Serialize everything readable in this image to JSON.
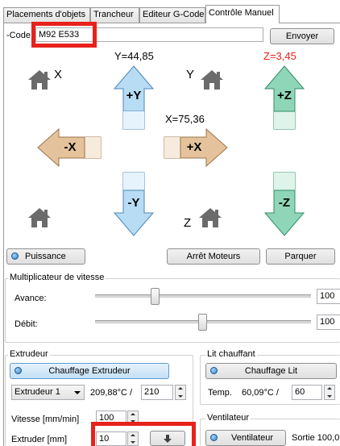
{
  "tabs": [
    "Placements d'objets",
    "Trancheur",
    "Editeur G-Code",
    "Contrôle Manuel"
  ],
  "gcode": {
    "label": "-Code",
    "value": "M92 E533",
    "send": "Envoyer"
  },
  "positions": {
    "x": "X=75,36",
    "y": "Y=44,85",
    "z": "Z=3,45"
  },
  "home_labels": {
    "x": "X",
    "y": "Y",
    "z": "Z"
  },
  "jog": {
    "plus_y": "+Y",
    "minus_y": "-Y",
    "plus_x": "+X",
    "minus_x": "-X",
    "plus_z": "+Z",
    "minus_z": "-Z"
  },
  "power": {
    "label": "Puissance",
    "stop_motors": "Arrêt Moteurs",
    "park": "Parquer"
  },
  "speed": {
    "title": "Multiplicateur de vitesse",
    "feed_label": "Avance:",
    "feed_value": "100",
    "flow_label": "Débit:",
    "flow_value": "100"
  },
  "extruder": {
    "title": "Extrudeur",
    "heat": "Chauffage Extrudeur",
    "select": "Extrudeur 1",
    "temp": "209,88°C /",
    "target": "210",
    "speed_label": "Vitesse [mm/min]",
    "speed_value": "100",
    "extrude_label": "Extruder [mm]",
    "extrude_value": "10"
  },
  "bed": {
    "title": "Lit chauffant",
    "heat": "Chauffage Lit",
    "temp_label": "Temp.",
    "temp": "60,09°C /",
    "target": "60"
  },
  "fan": {
    "title": "Ventilateur",
    "button": "Ventilateur",
    "output": "Sortie 100,0"
  },
  "colors": {
    "accent_red": "#e8211b",
    "z_label_red": "#e8211b",
    "y_arrow": "#b8dcf4",
    "x_arrow": "#e4c39c",
    "z_arrow": "#8fd6b8"
  }
}
